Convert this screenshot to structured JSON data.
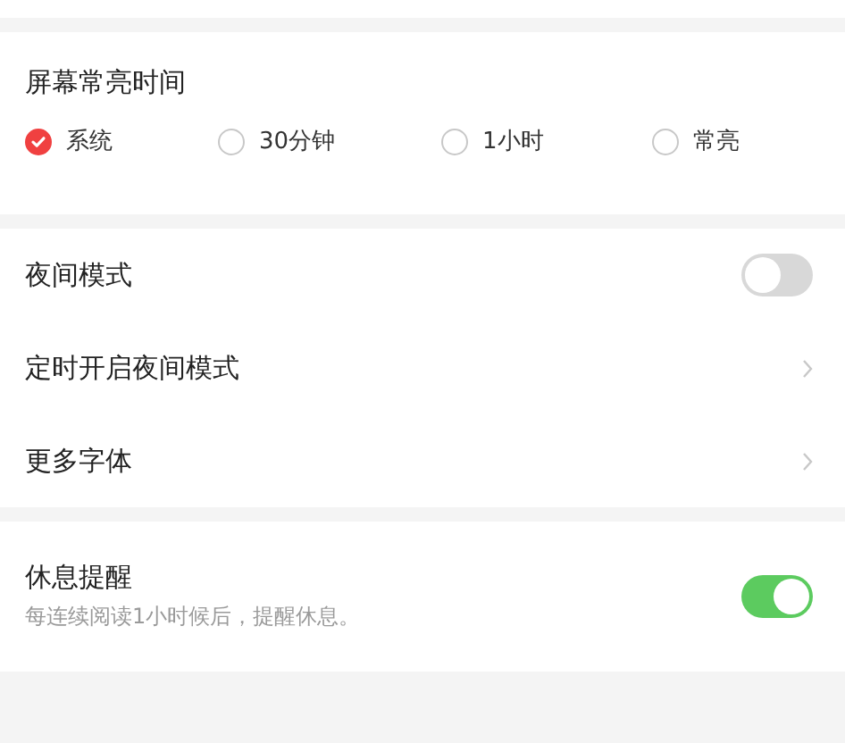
{
  "screen_timeout": {
    "title": "屏幕常亮时间",
    "options": [
      {
        "label": "系统",
        "selected": true
      },
      {
        "label": "30分钟",
        "selected": false
      },
      {
        "label": "1小时",
        "selected": false
      },
      {
        "label": "常亮",
        "selected": false
      }
    ]
  },
  "display_settings": [
    {
      "kind": "toggle",
      "label": "夜间模式",
      "on": false
    },
    {
      "kind": "link",
      "label": "定时开启夜间模式"
    },
    {
      "kind": "link",
      "label": "更多字体"
    }
  ],
  "rest_reminder": {
    "label": "休息提醒",
    "description": "每连续阅读1小时候后，提醒休息。",
    "on": true
  }
}
